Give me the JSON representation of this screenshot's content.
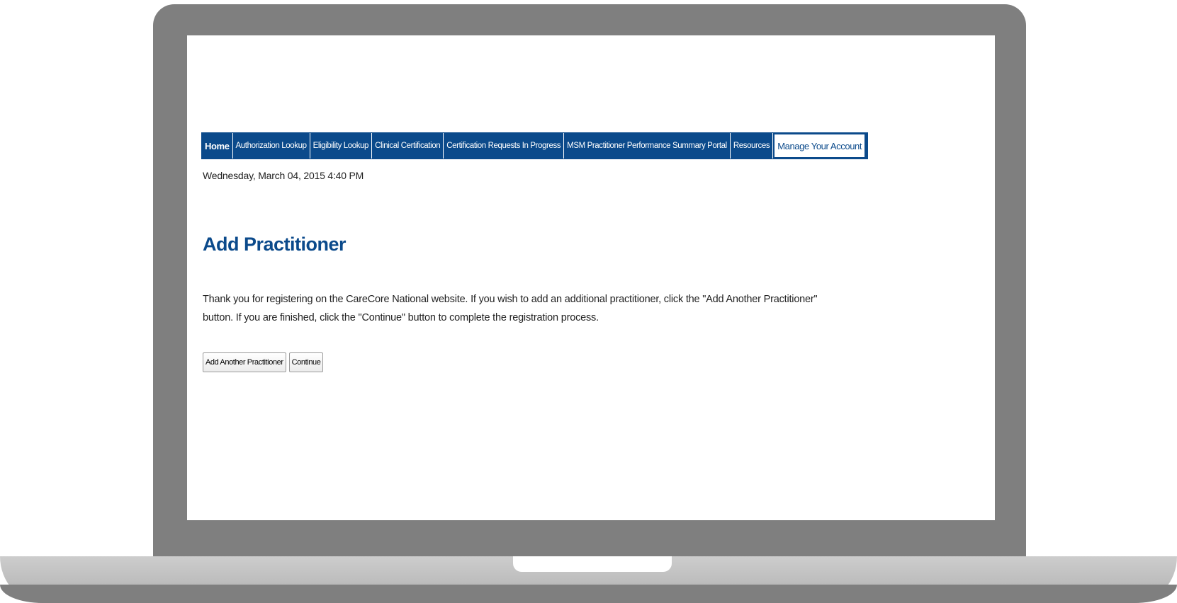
{
  "nav": {
    "items": [
      {
        "label": "Home"
      },
      {
        "label": "Authorization Lookup"
      },
      {
        "label": "Eligibility Lookup"
      },
      {
        "label": "Clinical Certification"
      },
      {
        "label": "Certification Requests In Progress"
      },
      {
        "label": "MSM Practitioner Performance Summary Portal"
      },
      {
        "label": "Resources"
      },
      {
        "label": "Manage Your Account"
      }
    ],
    "active": "Manage Your Account"
  },
  "datetime": "Wednesday, March 04, 2015 4:40 PM",
  "page": {
    "title": "Add Practitioner",
    "intro": "Thank you for registering on the CareCore National website. If you wish to add an additional practitioner, click the \"Add Another Practitioner\" button. If you are finished, click the \"Continue\" button to complete the registration process."
  },
  "buttons": {
    "add_another": "Add Another Practitioner",
    "continue": "Continue"
  },
  "colors": {
    "nav_bg": "#0b4a8b",
    "title": "#0b4a8b",
    "laptop_frame": "#7f7f7f"
  }
}
